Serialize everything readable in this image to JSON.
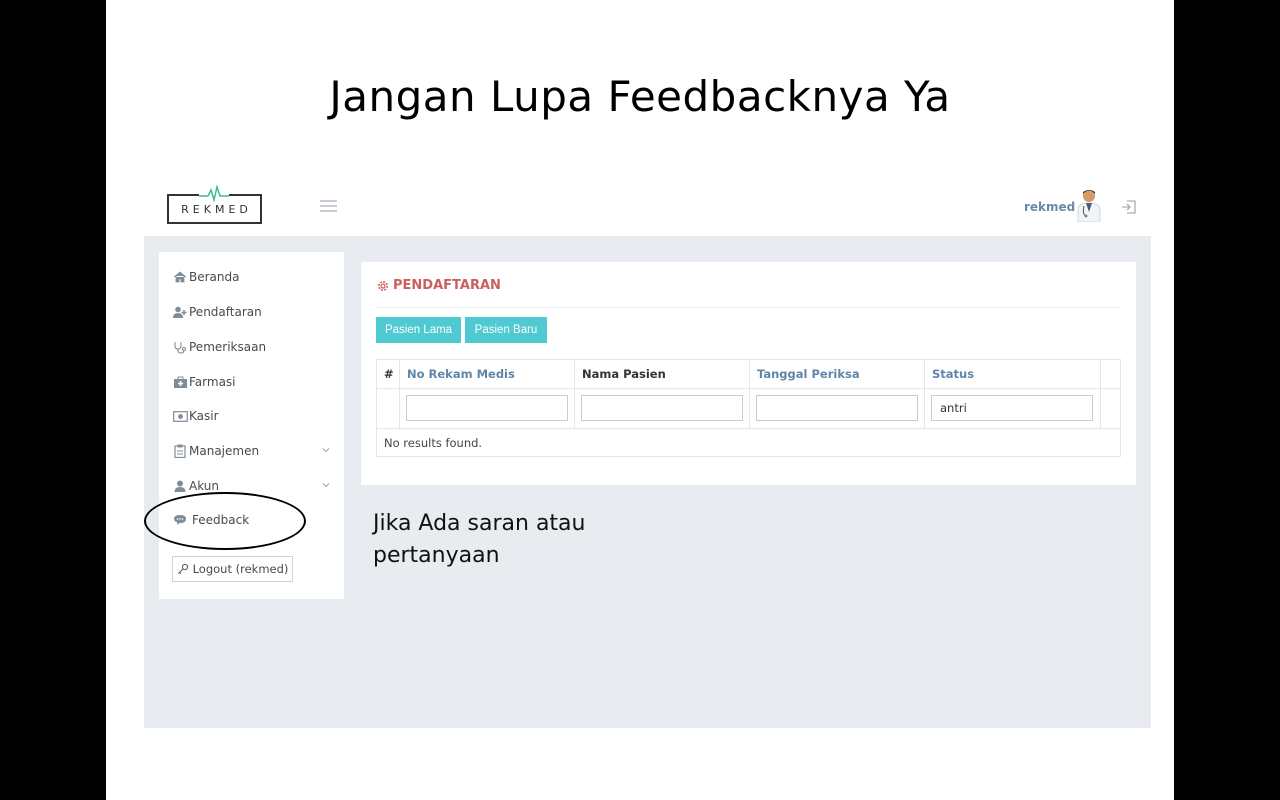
{
  "slide": {
    "title": "Jangan Lupa Feedbacknya Ya",
    "note_line1": "Jika Ada saran atau",
    "note_line2": "pertanyaan"
  },
  "header": {
    "logo_text": "REKMED",
    "username": "rekmed"
  },
  "sidebar": {
    "items": [
      {
        "label": "Beranda",
        "icon": "home-icon"
      },
      {
        "label": "Pendaftaran",
        "icon": "user-plus-icon"
      },
      {
        "label": "Pemeriksaan",
        "icon": "stethoscope-icon"
      },
      {
        "label": "Farmasi",
        "icon": "medkit-icon"
      },
      {
        "label": "Kasir",
        "icon": "money-icon"
      },
      {
        "label": "Manajemen",
        "icon": "clipboard-icon",
        "expandable": true
      },
      {
        "label": "Akun",
        "icon": "user-icon",
        "expandable": true
      },
      {
        "label": "Feedback",
        "icon": "comment-icon"
      }
    ],
    "logout_label": "Logout (rekmed)"
  },
  "panel": {
    "title": "PENDAFTARAN",
    "buttons": {
      "old_patient": "Pasien Lama",
      "new_patient": "Pasien Baru"
    },
    "table": {
      "columns": [
        "#",
        "No Rekam Medis",
        "Nama Pasien",
        "Tanggal Periksa",
        "Status"
      ],
      "filters": {
        "no_rekam_medis": "",
        "nama_pasien": "",
        "tanggal_periksa": "",
        "status": "antri"
      },
      "empty_text": "No results found."
    }
  },
  "colors": {
    "accent": "#4fc9d2",
    "panel_title": "#c9605f",
    "link": "#5f86a9",
    "content_bg": "#e8ebf0"
  }
}
